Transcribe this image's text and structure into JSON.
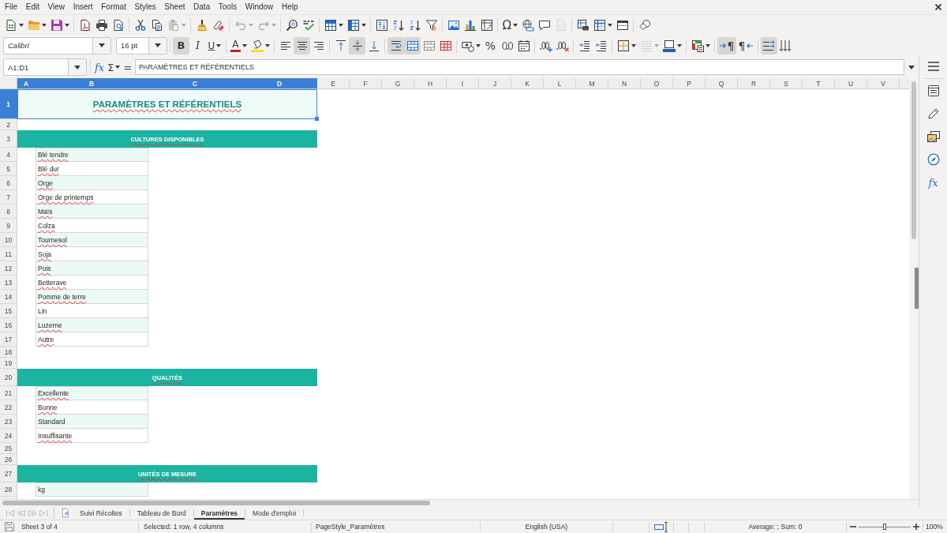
{
  "menu_bar": {
    "items": [
      "File",
      "Edit",
      "View",
      "Insert",
      "Format",
      "Styles",
      "Sheet",
      "Data",
      "Tools",
      "Window",
      "Help"
    ]
  },
  "standard_toolbar": [
    {
      "disabled": false
    },
    {
      "disabled": false
    },
    {
      "disabled": false
    },
    {
      "disabled": false
    },
    {
      "disabled": false
    },
    {
      "disabled": false
    },
    {
      "disabled": false
    },
    {
      "disabled": false
    },
    {
      "disabled": true
    },
    {
      "disabled": false
    },
    {
      "disabled": false
    },
    {
      "disabled": true
    },
    {
      "disabled": true
    },
    {
      "disabled": false
    },
    {
      "disabled": false
    },
    {
      "disabled": false
    },
    {
      "disabled": false
    },
    {
      "disabled": false
    },
    {
      "disabled": false
    },
    {
      "disabled": false
    },
    {
      "disabled": false
    },
    {
      "disabled": false
    },
    {
      "disabled": false
    },
    {
      "disabled": false
    },
    {
      "label": "Ω",
      "disabled": false
    },
    {
      "disabled": false
    },
    {
      "disabled": false
    },
    {
      "disabled": true
    },
    {
      "disabled": false
    },
    {
      "disabled": false
    },
    {
      "disabled": false
    },
    {
      "disabled": false
    }
  ],
  "format_toolbar": {
    "font_name": "Calibri",
    "font_size": "16 pt",
    "buttons": [
      {
        "label": "B",
        "on": true,
        "disabled": false
      },
      {
        "label": "I",
        "on": false,
        "disabled": false
      },
      {
        "label": "U",
        "on": false,
        "disabled": false
      },
      {
        "label": "A",
        "on": false,
        "disabled": false
      },
      {
        "on": false,
        "disabled": false
      },
      {
        "on": false,
        "disabled": false
      },
      {
        "on": true,
        "disabled": false
      },
      {
        "on": false,
        "disabled": false
      },
      {
        "on": false,
        "disabled": false
      },
      {
        "on": true,
        "disabled": false
      },
      {
        "on": false,
        "disabled": false
      },
      {
        "on": true,
        "disabled": false
      },
      {
        "on": true,
        "disabled": false
      },
      {
        "on": false,
        "disabled": false
      },
      {
        "on": false,
        "disabled": false
      },
      {
        "on": false,
        "disabled": false
      },
      {
        "label": "%",
        "on": false,
        "disabled": false
      },
      {
        "on": false,
        "disabled": false
      },
      {
        "on": false,
        "disabled": false
      },
      {
        "on": false,
        "disabled": false
      },
      {
        "on": false,
        "disabled": false
      },
      {
        "on": false,
        "disabled": false
      },
      {
        "on": false,
        "disabled": false
      },
      {
        "on": false,
        "disabled": false
      },
      {
        "on": false,
        "disabled": true
      },
      {
        "on": false,
        "disabled": false
      },
      {
        "on": false,
        "disabled": false
      },
      {
        "label": "¶",
        "on": true,
        "disabled": false
      },
      {
        "label": "¶",
        "on": false,
        "disabled": false
      },
      {
        "on": true,
        "disabled": false
      },
      {
        "on": false,
        "disabled": false
      }
    ]
  },
  "formula_bar": {
    "name_box": "A1:D1",
    "function_wizard": "fx",
    "sum": "Σ",
    "equals": "=",
    "value": "PARAMÈTRES ET RÉFÉRENTIELS"
  },
  "sidebar": {
    "functions": "fx"
  },
  "sheet": {
    "columns": [
      {
        "label": "A",
        "selected": true
      },
      {
        "label": "B",
        "selected": true
      },
      {
        "label": "C",
        "selected": true
      },
      {
        "label": "D",
        "selected": true
      },
      {
        "label": "E",
        "selected": false
      },
      {
        "label": "F",
        "selected": false
      },
      {
        "label": "G",
        "selected": false
      },
      {
        "label": "H",
        "selected": false
      },
      {
        "label": "I",
        "selected": false
      },
      {
        "label": "J",
        "selected": false
      },
      {
        "label": "K",
        "selected": false
      },
      {
        "label": "L",
        "selected": false
      },
      {
        "label": "M",
        "selected": false
      },
      {
        "label": "N",
        "selected": false
      },
      {
        "label": "O",
        "selected": false
      },
      {
        "label": "P",
        "selected": false
      },
      {
        "label": "Q",
        "selected": false
      },
      {
        "label": "R",
        "selected": false
      },
      {
        "label": "S",
        "selected": false
      },
      {
        "label": "T",
        "selected": false
      },
      {
        "label": "U",
        "selected": false
      },
      {
        "label": "V",
        "selected": false
      }
    ],
    "rows": [
      {
        "number": "1",
        "selected": true,
        "kind": "title",
        "text": "PARAMÈTRES ET RÉFÉRENTIELS",
        "misspelled": true
      },
      {
        "number": "2",
        "selected": false,
        "kind": "blank"
      },
      {
        "number": "3",
        "selected": false,
        "kind": "section",
        "text": "CULTURES DISPONIBLES",
        "misspelled": true
      },
      {
        "number": "4",
        "selected": false,
        "kind": "item",
        "text": "Blé tendre",
        "misspelled": true
      },
      {
        "number": "5",
        "selected": false,
        "kind": "item",
        "text": "Blé dur",
        "misspelled": true
      },
      {
        "number": "6",
        "selected": false,
        "kind": "item",
        "text": "Orge",
        "misspelled": true
      },
      {
        "number": "7",
        "selected": false,
        "kind": "item",
        "text": "Orge de printemps",
        "misspelled": true
      },
      {
        "number": "8",
        "selected": false,
        "kind": "item",
        "text": "Maïs",
        "misspelled": true
      },
      {
        "number": "9",
        "selected": false,
        "kind": "item",
        "text": "Colza",
        "misspelled": true
      },
      {
        "number": "10",
        "selected": false,
        "kind": "item",
        "text": "Tournesol",
        "misspelled": true
      },
      {
        "number": "11",
        "selected": false,
        "kind": "item",
        "text": "Soja",
        "misspelled": true
      },
      {
        "number": "12",
        "selected": false,
        "kind": "item",
        "text": "Pois",
        "misspelled": true
      },
      {
        "number": "13",
        "selected": false,
        "kind": "item",
        "text": "Betterave",
        "misspelled": true
      },
      {
        "number": "14",
        "selected": false,
        "kind": "item",
        "text": "Pomme de terre",
        "misspelled": true
      },
      {
        "number": "15",
        "selected": false,
        "kind": "item",
        "text": "Lin",
        "misspelled": false
      },
      {
        "number": "16",
        "selected": false,
        "kind": "item",
        "text": "Luzerne",
        "misspelled": true
      },
      {
        "number": "17",
        "selected": false,
        "kind": "item",
        "text": "Autre",
        "misspelled": true
      },
      {
        "number": "18",
        "selected": false,
        "kind": "blank"
      },
      {
        "number": "19",
        "selected": false,
        "kind": "blank"
      },
      {
        "number": "20",
        "selected": false,
        "kind": "section",
        "text": "QUALITÉS",
        "misspelled": true
      },
      {
        "number": "21",
        "selected": false,
        "kind": "item",
        "text": "Excellente",
        "misspelled": true
      },
      {
        "number": "22",
        "selected": false,
        "kind": "item",
        "text": "Bonne",
        "misspelled": true
      },
      {
        "number": "23",
        "selected": false,
        "kind": "item",
        "text": "Standard",
        "misspelled": false
      },
      {
        "number": "24",
        "selected": false,
        "kind": "item",
        "text": "Insuffisante",
        "misspelled": true
      },
      {
        "number": "25",
        "selected": false,
        "kind": "blank"
      },
      {
        "number": "26",
        "selected": false,
        "kind": "blank"
      },
      {
        "number": "27",
        "selected": false,
        "kind": "section",
        "text": "UNITÉS DE MESURE",
        "misspelled": true
      },
      {
        "number": "28",
        "selected": false,
        "kind": "item",
        "text": "kg",
        "misspelled": false
      }
    ]
  },
  "sheet_tabs": {
    "navigation": [
      {
        "disabled": true
      },
      {
        "disabled": true
      },
      {
        "disabled": true
      },
      {
        "disabled": true
      }
    ],
    "tabs": [
      {
        "label": "Suivi Récoltes",
        "selected": false
      },
      {
        "label": "Tableau de Bord",
        "selected": false
      },
      {
        "label": "Paramètres",
        "selected": true
      },
      {
        "label": "Mode d'emploi",
        "selected": false
      }
    ]
  },
  "status_bar": {
    "sheet": "Sheet 3 of 4",
    "selection": "Selected: 1 row, 4 columns",
    "page_style": "PageStyle_Paramètres",
    "language": "English (USA)",
    "summary": "Average: ; Sum: 0",
    "zoom": {
      "level": 0.5,
      "value": "100%"
    }
  }
}
